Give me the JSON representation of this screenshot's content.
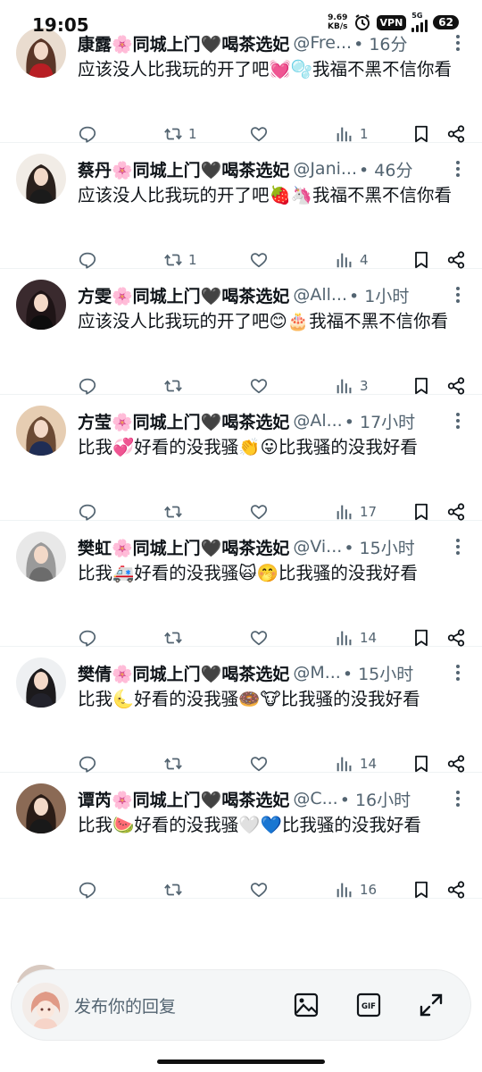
{
  "status_bar": {
    "time": "19:05",
    "net_speed_value": "9.69",
    "net_speed_unit": "KB/s",
    "vpn_label": "VPN",
    "signal_label": "5G",
    "battery": "62"
  },
  "tweets": [
    {
      "name": "康露🌸同城上门🖤喝茶选妃",
      "handle": "@Fre...",
      "time": "• 16分",
      "text": "应该没人比我玩的开了吧💓🫧我福不黑不信你看",
      "reply_count": "",
      "retweet_count": "1",
      "like_count": "",
      "view_count": "1",
      "avatar_colors": [
        "#e9dccf",
        "#5a3526",
        "#b81e24"
      ]
    },
    {
      "name": "蔡丹🌸同城上门🖤喝茶选妃",
      "handle": "@Jani...",
      "time": "• 46分",
      "text": "应该没人比我玩的开了吧🍓🦄我福不黑不信你看",
      "reply_count": "",
      "retweet_count": "1",
      "like_count": "",
      "view_count": "4",
      "avatar_colors": [
        "#f1ece6",
        "#2a201c",
        "#1b1b1b"
      ]
    },
    {
      "name": "方雯🌸同城上门🖤喝茶选妃",
      "handle": "@All...",
      "time": "• 1小时",
      "text": "应该没人比我玩的开了吧😊🎂我福不黑不信你看",
      "reply_count": "",
      "retweet_count": "",
      "like_count": "",
      "view_count": "3",
      "avatar_colors": [
        "#3a2a2e",
        "#1e1416",
        "#0d0d0d"
      ]
    },
    {
      "name": "方莹🌸同城上门🖤喝茶选妃",
      "handle": "@Al...",
      "time": "• 17小时",
      "text": "比我💞好看的没我骚👏😛比我骚的没我好看",
      "reply_count": "",
      "retweet_count": "",
      "like_count": "",
      "view_count": "17",
      "avatar_colors": [
        "#e6cdb2",
        "#6b4a34",
        "#1f2d55"
      ]
    },
    {
      "name": "樊虹🌸同城上门🖤喝茶选妃",
      "handle": "@Vi...",
      "time": "• 15小时",
      "text": "比我🚑好看的没我骚🙀🤭比我骚的没我好看",
      "reply_count": "",
      "retweet_count": "",
      "like_count": "",
      "view_count": "14",
      "avatar_colors": [
        "#e8e8e8",
        "#9a9a9a",
        "#6c6c6c"
      ]
    },
    {
      "name": "樊倩🌸同城上门🖤喝茶选妃",
      "handle": "@M...",
      "time": "• 15小时",
      "text": "比我🌜好看的没我骚🍩🐮比我骚的没我好看",
      "reply_count": "",
      "retweet_count": "",
      "like_count": "",
      "view_count": "14",
      "avatar_colors": [
        "#eef0f2",
        "#1c1a1c",
        "#22222b"
      ]
    },
    {
      "name": "谭芮🌸同城上门🖤喝茶选妃",
      "handle": "@C...",
      "time": "• 16小时",
      "text": "比我🍉好看的没我骚🤍💙比我骚的没我好看",
      "reply_count": "",
      "retweet_count": "",
      "like_count": "",
      "view_count": "16",
      "avatar_colors": [
        "#8b6a55",
        "#2a1c16",
        "#191919"
      ]
    }
  ],
  "reply_bar": {
    "placeholder": "发布你的回复"
  },
  "icons": {
    "reply": "reply-icon",
    "retweet": "retweet-icon",
    "like": "like-icon",
    "views": "views-icon",
    "bookmark": "bookmark-icon",
    "share": "share-icon",
    "more": "more-icon",
    "image": "image-icon",
    "gif": "gif-icon",
    "expand": "expand-icon"
  },
  "colors": {
    "text": "#0f1419",
    "muted": "#536471",
    "divider": "#eff3f4"
  }
}
